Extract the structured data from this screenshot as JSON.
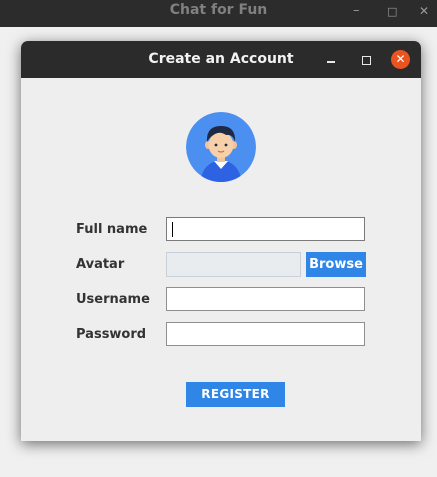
{
  "parent_window": {
    "title": "Chat for Fun",
    "controls": {
      "minimize": "–",
      "maximize": "□",
      "close": "✕"
    }
  },
  "dialog": {
    "title": "Create an Account",
    "avatar_icon": "user-avatar-icon",
    "form": {
      "full_name": {
        "label": "Full name",
        "value": ""
      },
      "avatar": {
        "label": "Avatar",
        "value": "",
        "browse_label": "Browse"
      },
      "username": {
        "label": "Username",
        "value": ""
      },
      "password": {
        "label": "Password",
        "value": ""
      }
    },
    "register_label": "REGISTER"
  },
  "colors": {
    "accent": "#2f86e6",
    "close_button": "#e95420",
    "titlebar": "#2b2b2b"
  }
}
